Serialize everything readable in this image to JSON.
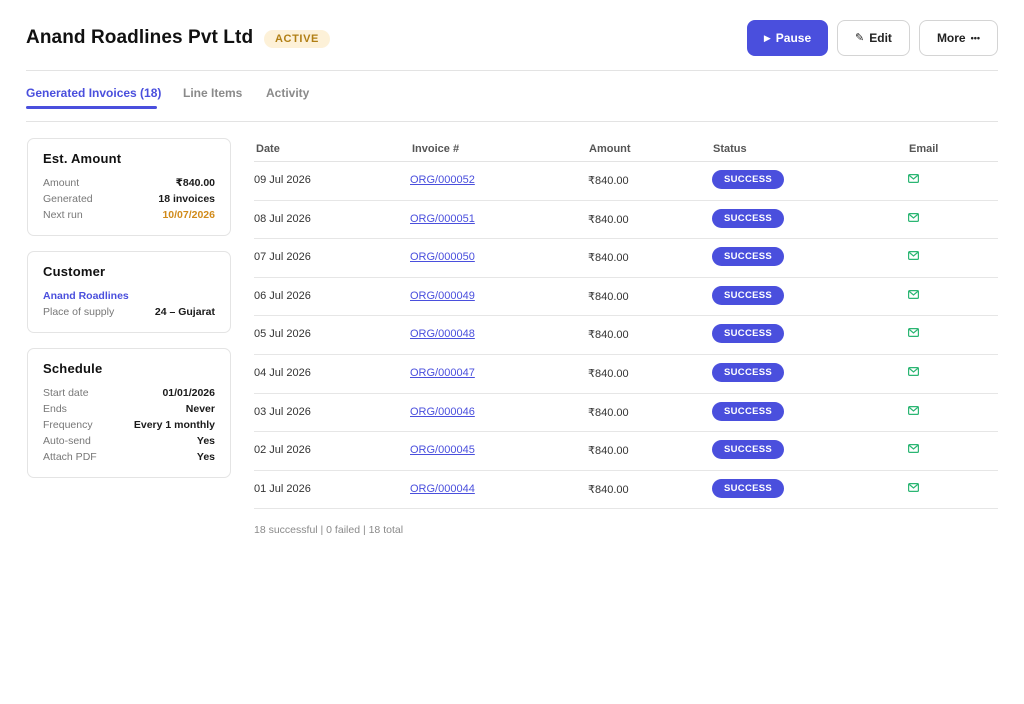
{
  "header": {
    "title": "Anand Roadlines Pvt Ltd",
    "status_badge": "ACTIVE",
    "pause_label": "Pause",
    "edit_label": "Edit",
    "more_label": "More",
    "icons": {
      "pause": "play-triangle-icon",
      "edit": "pencil-icon",
      "more": "ellipsis-icon"
    }
  },
  "tabs": [
    {
      "label": "Generated Invoices (18)",
      "active": true
    },
    {
      "label": "Line Items",
      "active": false
    },
    {
      "label": "Activity",
      "active": false
    }
  ],
  "est_amount": {
    "title": "Est. Amount",
    "rows": [
      {
        "key": "Amount",
        "value": "₹840.00"
      },
      {
        "key": "Generated",
        "value": "18 invoices"
      },
      {
        "key": "Next run",
        "value": "10/07/2026"
      }
    ]
  },
  "customer": {
    "title": "Customer",
    "name": "Anand Roadlines",
    "rows": [
      {
        "key": "Place of supply",
        "value": "24 – Gujarat"
      }
    ]
  },
  "schedule": {
    "title": "Schedule",
    "rows": [
      {
        "key": "Start date",
        "value": "01/01/2026"
      },
      {
        "key": "Ends",
        "value": "Never"
      },
      {
        "key": "Frequency",
        "value": "Every 1 monthly"
      },
      {
        "key": "Auto-send",
        "value": "Yes"
      },
      {
        "key": "Attach PDF",
        "value": "Yes"
      }
    ]
  },
  "table": {
    "headers": {
      "date": "Date",
      "invoice": "Invoice #",
      "amount": "Amount",
      "status": "Status",
      "email": "Email"
    },
    "rows": [
      {
        "date": "09 Jul 2026",
        "invoice": "ORG/000052",
        "amount": "₹840.00",
        "status": "SUCCESS"
      },
      {
        "date": "08 Jul 2026",
        "invoice": "ORG/000051",
        "amount": "₹840.00",
        "status": "SUCCESS"
      },
      {
        "date": "07 Jul 2026",
        "invoice": "ORG/000050",
        "amount": "₹840.00",
        "status": "SUCCESS"
      },
      {
        "date": "06 Jul 2026",
        "invoice": "ORG/000049",
        "amount": "₹840.00",
        "status": "SUCCESS"
      },
      {
        "date": "05 Jul 2026",
        "invoice": "ORG/000048",
        "amount": "₹840.00",
        "status": "SUCCESS"
      },
      {
        "date": "04 Jul 2026",
        "invoice": "ORG/000047",
        "amount": "₹840.00",
        "status": "SUCCESS"
      },
      {
        "date": "03 Jul 2026",
        "invoice": "ORG/000046",
        "amount": "₹840.00",
        "status": "SUCCESS"
      },
      {
        "date": "02 Jul 2026",
        "invoice": "ORG/000045",
        "amount": "₹840.00",
        "status": "SUCCESS"
      },
      {
        "date": "01 Jul 2026",
        "invoice": "ORG/000044",
        "amount": "₹840.00",
        "status": "SUCCESS"
      }
    ],
    "summary": "18 successful | 0 failed | 18 total"
  },
  "colors": {
    "accent": "#4a4fdd",
    "badge_bg": "#fdf1d8",
    "badge_text": "#b17f14",
    "next_run": "#d18b1b",
    "email_icon": "#2bb673"
  }
}
